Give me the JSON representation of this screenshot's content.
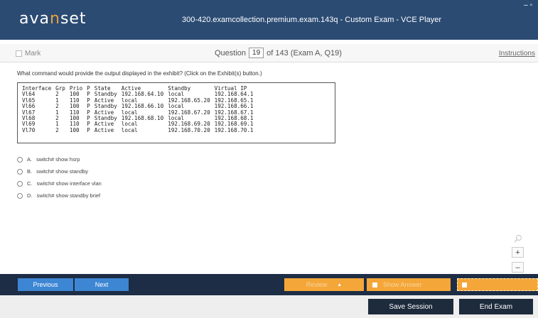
{
  "app": {
    "logo_main": "ava",
    "logo_accent": "n",
    "logo_tail": "set",
    "window_title": "300-420.examcollection.premium.exam.143q - Custom Exam - VCE Player",
    "window_controls": "– ▫"
  },
  "question_bar": {
    "mark_label": "Mark",
    "question_label": "Question",
    "question_number": "19",
    "question_of": "of 143 (Exam A, Q19)",
    "instructions_label": "Instructions"
  },
  "question": {
    "text": "What command would provide the output displayed in the exhibit? (Click on the Exhibit(s) button.)"
  },
  "exhibit": {
    "headers": [
      "Interface",
      "Grp",
      "Prio",
      "P",
      "State",
      "Active",
      "Standby",
      "Virtual IP"
    ],
    "rows": [
      [
        "Vl64",
        "2",
        "100",
        "P",
        "Standby",
        "192.168.64.10",
        "local",
        "192.168.64.1"
      ],
      [
        "Vl65",
        "1",
        "110",
        "P",
        "Active",
        "local",
        "192.168.65.20",
        "192.168.65.1"
      ],
      [
        "Vl66",
        "2",
        "100",
        "P",
        "Standby",
        "192.168.66.10",
        "local",
        "192.168.66.1"
      ],
      [
        "Vl67",
        "1",
        "110",
        "P",
        "Active",
        "local",
        "192.168.67.20",
        "192.168.67.1"
      ],
      [
        "Vl68",
        "2",
        "100",
        "P",
        "Standby",
        "192.168.68.10",
        "local",
        "192.168.68.1"
      ],
      [
        "Vl69",
        "1",
        "110",
        "P",
        "Active",
        "local",
        "192.168.69.20",
        "192.168.69.1"
      ],
      [
        "Vl70",
        "2",
        "100",
        "P",
        "Active",
        "local",
        "192.168.70.20",
        "192.168.70.1"
      ]
    ]
  },
  "options": [
    {
      "letter": "A.",
      "text": "switch# show hsrp"
    },
    {
      "letter": "B.",
      "text": "switch# show standby"
    },
    {
      "letter": "C.",
      "text": "switch# show interface vlan"
    },
    {
      "letter": "D.",
      "text": "switch# show standby brief"
    }
  ],
  "zoom": {
    "plus": "+",
    "minus": "–",
    "icon": "magnifier-icon"
  },
  "nav": {
    "previous_label": "Previous",
    "next_label": "Next",
    "review_label": "Review",
    "review_caret": "▲",
    "show_answer_label": "Show Answer"
  },
  "bottom": {
    "save_label": "Save Session",
    "end_label": "End Exam"
  },
  "colors": {
    "title_bar": "#2b4b73",
    "nav_bar": "#1d2d45",
    "nav_button": "#3d86d3",
    "accent_orange": "#f4a639",
    "dark_button": "#1e2b3c"
  }
}
